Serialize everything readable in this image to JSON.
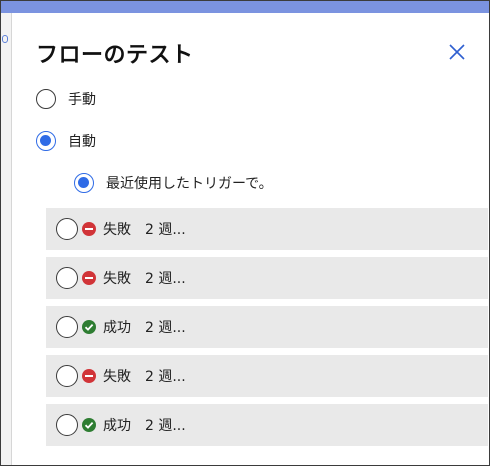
{
  "panel": {
    "title": "フローのテスト",
    "close_icon": "close-icon"
  },
  "options": {
    "manual_label": "手動",
    "manual_selected": false,
    "automatic_label": "自動",
    "automatic_selected": true,
    "recent_trigger_label": "最近使用したトリガーで。",
    "recent_trigger_selected": true
  },
  "colors": {
    "accent": "#2f6be6",
    "top_bar": "#7b93e0",
    "failed": "#d13438",
    "succeeded": "#2e7d32",
    "row_background": "#e9e9e9"
  },
  "runs": [
    {
      "status": "失敗",
      "status_type": "failed",
      "time": "2 週..."
    },
    {
      "status": "失敗",
      "status_type": "failed",
      "time": "2 週..."
    },
    {
      "status": "成功",
      "status_type": "success",
      "time": "2 週..."
    },
    {
      "status": "失敗",
      "status_type": "failed",
      "time": "2 週..."
    },
    {
      "status": "成功",
      "status_type": "success",
      "time": "2 週..."
    }
  ]
}
